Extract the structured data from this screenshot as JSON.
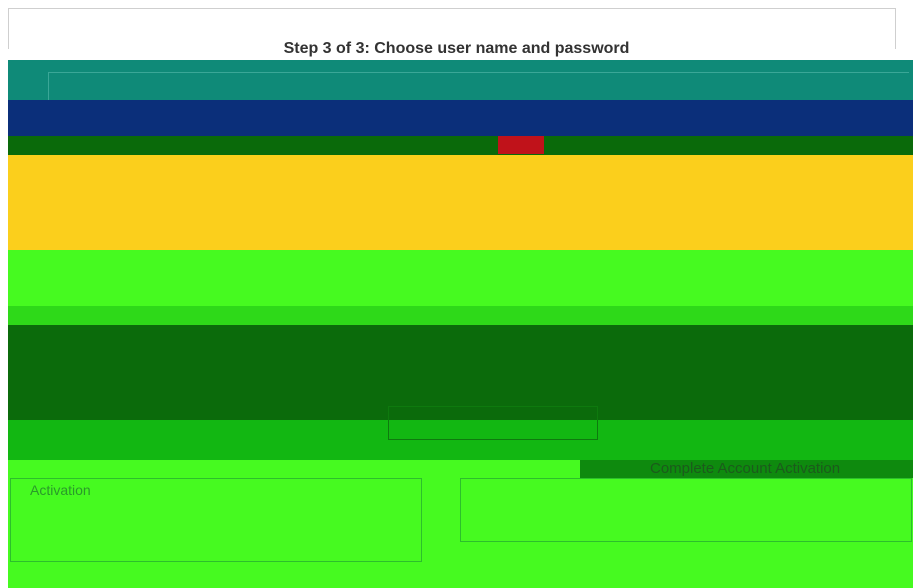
{
  "wizard": {
    "title": "Step 3 of 3: Choose user name and password",
    "complete_button": "Complete Account Activation",
    "field_caption": "Activation"
  },
  "colors": {
    "teal": "#0f8a78",
    "blue": "#0b2f7a",
    "yellow": "#fbcf1c",
    "green": "#46fa20",
    "dark_green": "#0b6b0b",
    "red": "#c0121a"
  }
}
